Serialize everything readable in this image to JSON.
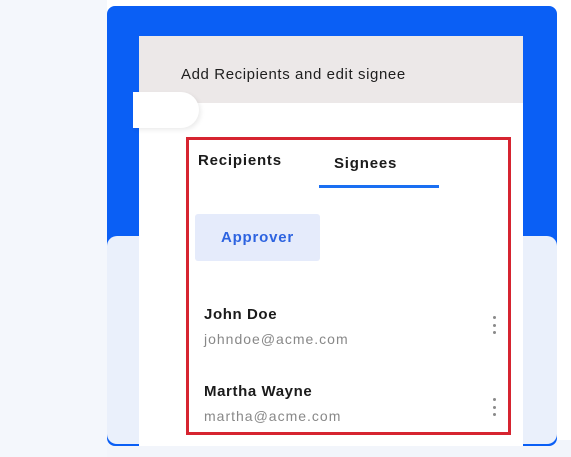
{
  "modal": {
    "title": "Add Recipients and edit signee"
  },
  "tabs": [
    {
      "label": "Recipients",
      "active": false
    },
    {
      "label": "Signees",
      "active": true
    }
  ],
  "role_filter": {
    "label": "Approver"
  },
  "signees": [
    {
      "name": "John Doe",
      "email": "johndoe@acme.com",
      "menu_icon": "more-vertical-icon"
    },
    {
      "name": "Martha Wayne",
      "email": "martha@acme.com",
      "menu_icon": "more-vertical-icon"
    }
  ],
  "colors": {
    "brand_blue": "#0a5ff5",
    "tab_underline": "#1a6ff2",
    "chip_text": "#2d63e0",
    "chip_bg": "#e5ebfb",
    "highlight_border": "#d62430"
  }
}
